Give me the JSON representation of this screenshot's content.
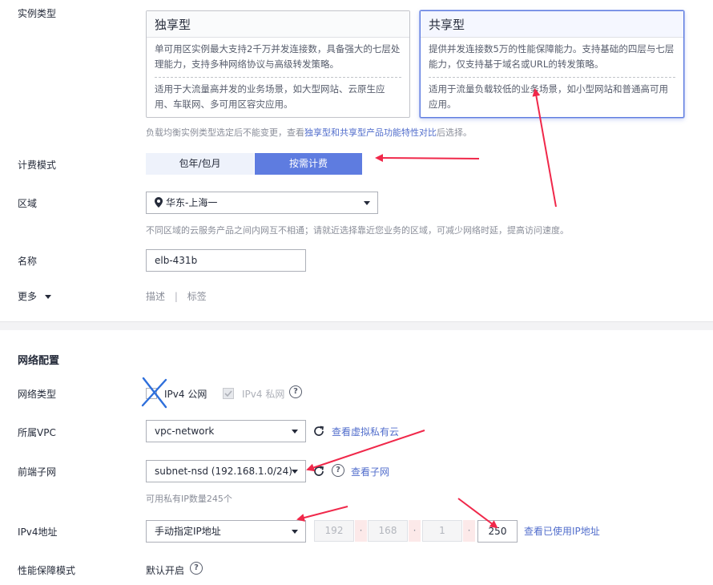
{
  "instance": {
    "label": "实例类型",
    "cards": [
      {
        "title": "独享型",
        "desc1": "单可用区实例最大支持2千万并发连接数，具备强大的七层处理能力，支持多种网络协议与高级转发策略。",
        "desc2": "适用于大流量高并发的业务场景，如大型网站、云原生应用、车联网、多可用区容灾应用。"
      },
      {
        "title": "共享型",
        "desc1": "提供并发连接数5万的性能保障能力。支持基础的四层与七层能力，仅支持基于域名或URL的转发策略。",
        "desc2": "适用于流量负载较低的业务场景，如小型网站和普通高可用应用。"
      }
    ],
    "hint_prefix": "负载均衡实例类型选定后不能变更，查看",
    "hint_link": "独享型和共享型产品功能特性对比",
    "hint_suffix": "后选择。"
  },
  "billing": {
    "label": "计费模式",
    "options": [
      "包年/包月",
      "按需计费"
    ],
    "selected": "按需计费"
  },
  "region": {
    "label": "区域",
    "value": "华东-上海一",
    "hint": "不同区域的云服务产品之间内网互不相通；请就近选择靠近您业务的区域，可减少网络时延，提高访问速度。"
  },
  "name": {
    "label": "名称",
    "value": "elb-431b"
  },
  "more": {
    "label": "更多",
    "links": [
      "描述",
      "标签"
    ],
    "separator": "|"
  },
  "network": {
    "section_title": "网络配置",
    "type_label": "网络类型",
    "ipv4_public": "IPv4 公网",
    "ipv4_private": "IPv4 私网",
    "vpc_label": "所属VPC",
    "vpc_value": "vpc-network",
    "vpc_link": "查看虚拟私有云",
    "subnet_label": "前端子网",
    "subnet_value": "subnet-nsd (192.168.1.0/24)",
    "subnet_link": "查看子网",
    "subnet_hint": "可用私有IP数量245个",
    "ipv4_label": "IPv4地址",
    "ipv4_mode": "手动指定IP地址",
    "ip_octets": [
      "192",
      "168",
      "1",
      "250"
    ],
    "ip_dot": "·",
    "ip_link": "查看已使用IP地址",
    "perf_label": "性能保障模式",
    "perf_value": "默认开启"
  },
  "icons": {
    "help": "?",
    "annotation_color": "#f0284a"
  }
}
